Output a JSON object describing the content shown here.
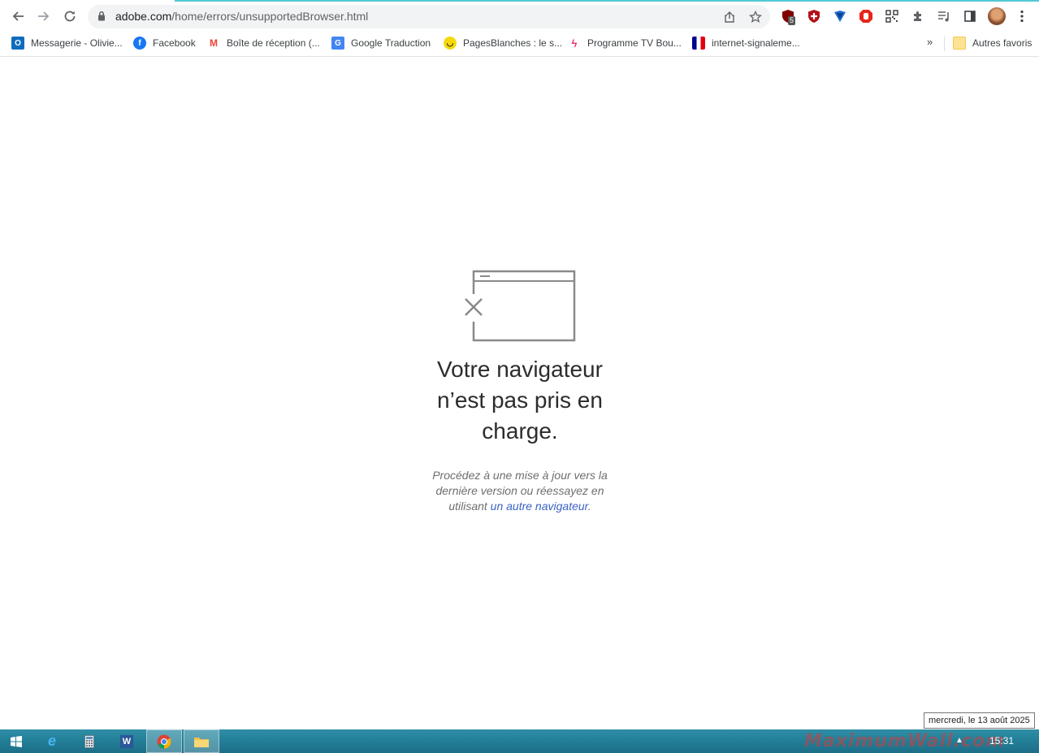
{
  "browser": {
    "url_host": "adobe.com",
    "url_path": "/home/errors/unsupportedBrowser.html",
    "extension_badge": "5"
  },
  "bookmarks": [
    {
      "label": "Messagerie - Olivie...",
      "icon": "outlook-icon",
      "color": "#0f6cbd"
    },
    {
      "label": "Facebook",
      "icon": "facebook-icon",
      "color": "#1877f2"
    },
    {
      "label": "Boîte de réception (...",
      "icon": "gmail-icon",
      "color": "#ea4335"
    },
    {
      "label": "Google Traduction",
      "icon": "google-translate-icon",
      "color": "#4285f4"
    },
    {
      "label": "PagesBlanches : le s...",
      "icon": "pagesblanches-icon",
      "color": "#f5d90a"
    },
    {
      "label": "Programme TV Bou...",
      "icon": "tv-icon",
      "color": "#e8336d"
    },
    {
      "label": "internet-signaleme...",
      "icon": "gouv-fr-icon",
      "color": "#000091"
    }
  ],
  "bookmarks_more": "»",
  "other_bookmarks": "Autres favoris",
  "error": {
    "title_line1": "Votre navigateur",
    "title_line2": "n’est pas pris en",
    "title_line3": "charge.",
    "desc_part1": "Procédez à une mise à jour vers la dernière version ou réessayez en utilisant ",
    "desc_link": "un autre navigateur",
    "desc_part2": "."
  },
  "taskbar": {
    "date_tooltip": "mercredi, le 13 août 2025",
    "clock": "15:31",
    "watermark": "MaximumWall.com"
  }
}
